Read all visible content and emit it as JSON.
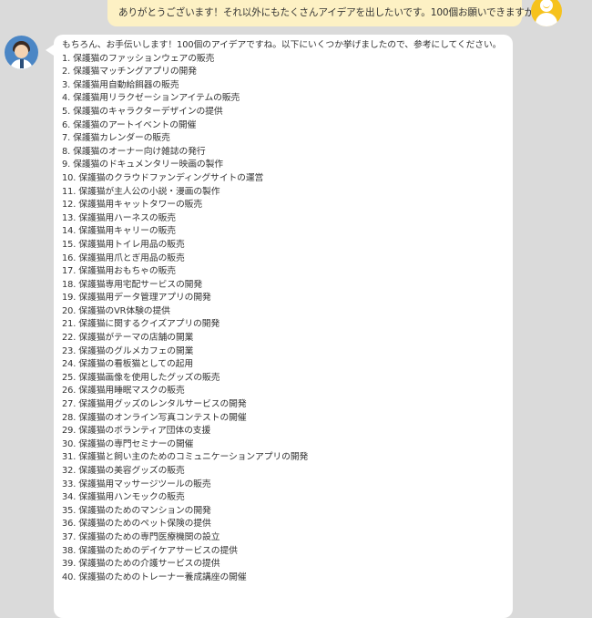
{
  "user_message": {
    "text": "ありがとうございます！それ以外にもたくさんアイデアを出したいです。100個お願いできますか？"
  },
  "assistant_message": {
    "intro": "もちろん、お手伝いします！100個のアイデアですね。以下にいくつか挙げましたので、参考にしてください。",
    "ideas": [
      "1. 保護猫のファッションウェアの販売",
      "2. 保護猫マッチングアプリの開発",
      "3. 保護猫用自動給餌器の販売",
      "4. 保護猫用リラクゼーションアイテムの販売",
      "5. 保護猫のキャラクターデザインの提供",
      "6. 保護猫のアートイベントの開催",
      "7. 保護猫カレンダーの販売",
      "8. 保護猫のオーナー向け雑誌の発行",
      "9. 保護猫のドキュメンタリー映画の製作",
      "10. 保護猫のクラウドファンディングサイトの運営",
      "11. 保護猫が主人公の小説・漫画の製作",
      "12. 保護猫用キャットタワーの販売",
      "13. 保護猫用ハーネスの販売",
      "14. 保護猫用キャリーの販売",
      "15. 保護猫用トイレ用品の販売",
      "16. 保護猫用爪とぎ用品の販売",
      "17. 保護猫用おもちゃの販売",
      "18. 保護猫専用宅配サービスの開発",
      "19. 保護猫用データ管理アプリの開発",
      "20. 保護猫のVR体験の提供",
      "21. 保護猫に関するクイズアプリの開発",
      "22. 保護猫がテーマの店舗の開業",
      "23. 保護猫のグルメカフェの開業",
      "24. 保護猫の看板猫としての起用",
      "25. 保護猫画像を使用したグッズの販売",
      "26. 保護猫用睡眠マスクの販売",
      "27. 保護猫用グッズのレンタルサービスの開発",
      "28. 保護猫のオンライン写真コンテストの開催",
      "29. 保護猫のボランティア団体の支援",
      "30. 保護猫の専門セミナーの開催",
      "31. 保護猫と飼い主のためのコミュニケーションアプリの開発",
      "32. 保護猫の美容グッズの販売",
      "33. 保護猫用マッサージツールの販売",
      "34. 保護猫用ハンモックの販売",
      "35. 保護猫のためのマンションの開発",
      "36. 保護猫のためのペット保険の提供",
      "37. 保護猫のための専門医療機関の設立",
      "38. 保護猫のためのデイケアサービスの提供",
      "39. 保護猫のための介護サービスの提供",
      "40. 保護猫のためのトレーナー養成講座の開催"
    ]
  }
}
